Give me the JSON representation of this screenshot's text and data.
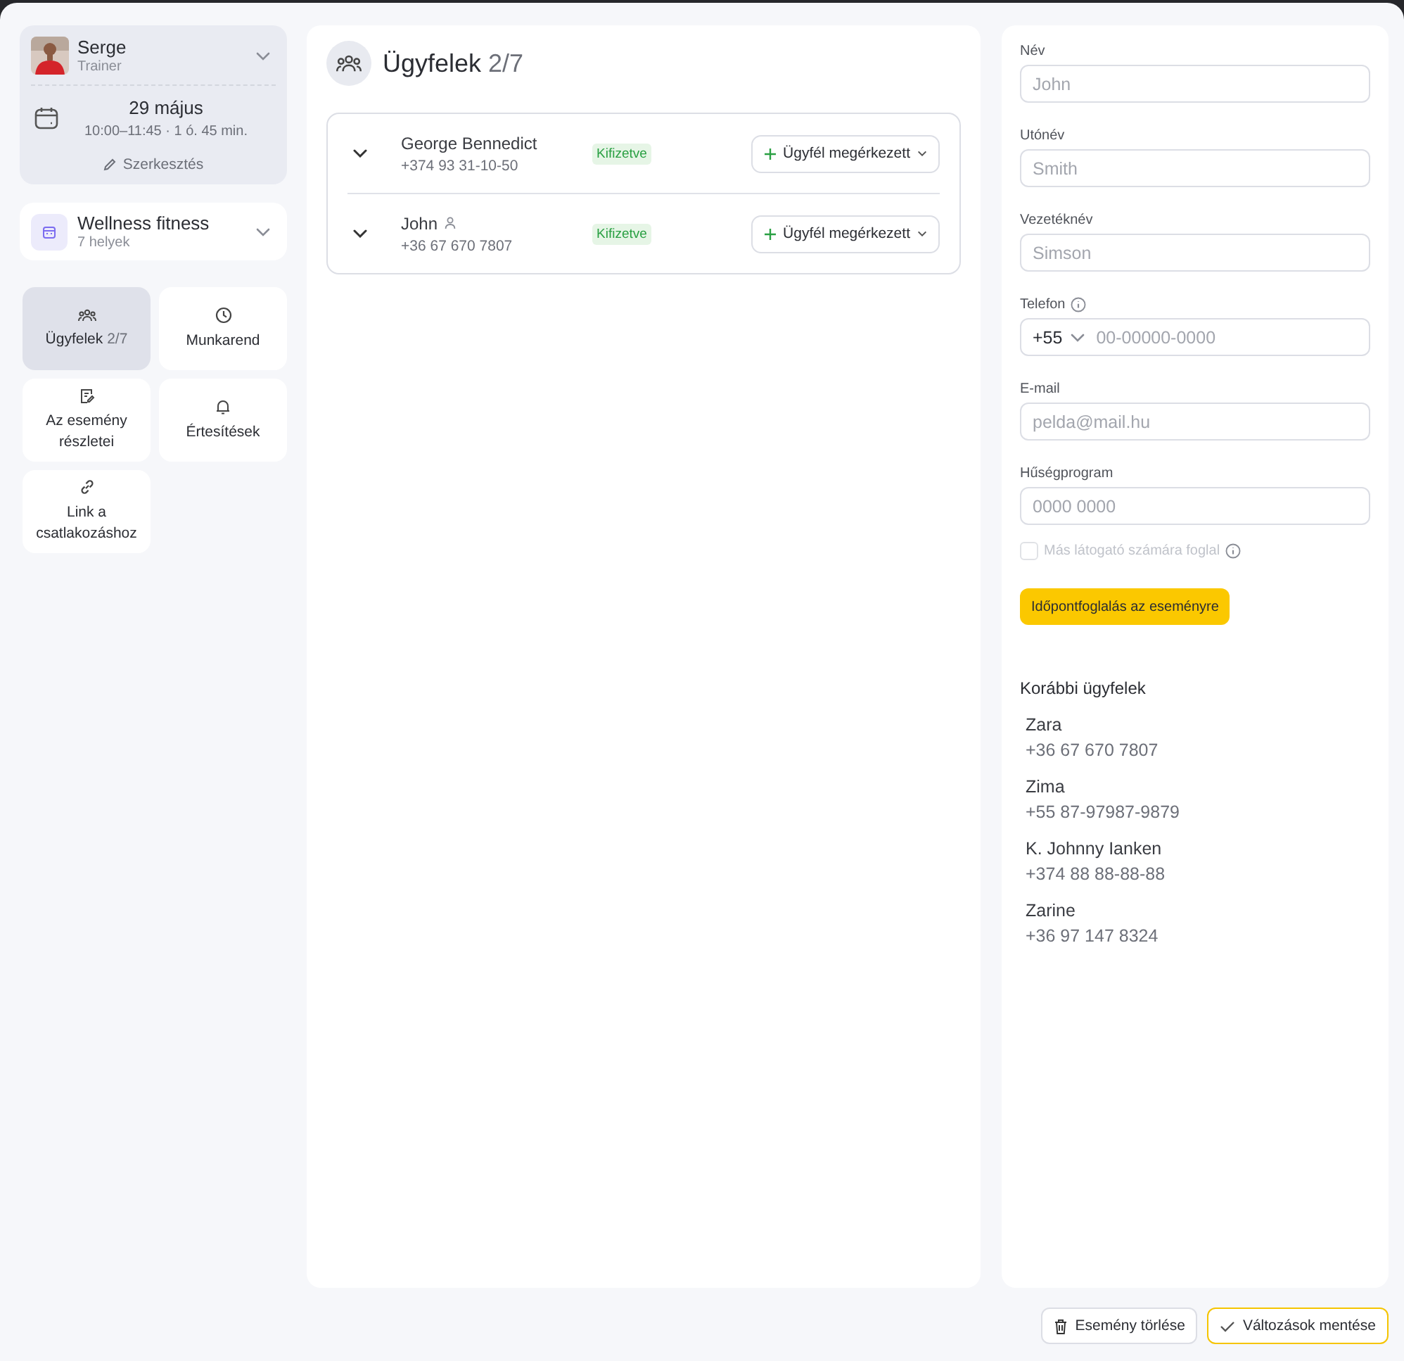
{
  "trainer": {
    "name": "Serge",
    "role": "Trainer",
    "expanded": false
  },
  "event": {
    "date": "29 május",
    "time": "10:00–11:45 · 1 ó. 45 min.",
    "edit": "Szerkesztés"
  },
  "location": {
    "name": "Wellness fitness",
    "places": "7 helyek",
    "expanded": false
  },
  "nav": [
    {
      "label": "Ügyfelek",
      "count": "2/7",
      "selected": true
    },
    {
      "label": "Munkarend",
      "selected": false
    },
    {
      "label": "Az esemény részletei",
      "selected": false
    },
    {
      "label": "Értesítések",
      "selected": false
    },
    {
      "label": "Link a csatlakozáshoz",
      "selected": false
    }
  ],
  "clients": {
    "title": "Ügyfelek",
    "count": "2/7",
    "rows": [
      {
        "name": "George Bennedict",
        "phone": "+374 93 31-10-50",
        "has_account": false,
        "status": "Kifizetve",
        "action": "Ügyfél megérkezett",
        "expanded": false
      },
      {
        "name": "John",
        "phone": "+36 67 670 7807",
        "has_account": true,
        "status": "Kifizetve",
        "action": "Ügyfél megérkezett",
        "expanded": false
      }
    ]
  },
  "form": {
    "fields": [
      {
        "kind": "text",
        "label": "Név",
        "placeholder": "John",
        "info": false
      },
      {
        "kind": "text",
        "label": "Utónév",
        "placeholder": "Smith",
        "info": false
      },
      {
        "kind": "text",
        "label": "Vezetéknév",
        "placeholder": "Simson",
        "info": false
      },
      {
        "kind": "phone",
        "label": "Telefon",
        "prefix": "+55",
        "placeholder": "00-00000-0000",
        "info": true
      },
      {
        "kind": "text",
        "label": "E-mail",
        "placeholder": "pelda@mail.hu",
        "info": false
      },
      {
        "kind": "text",
        "label": "Hűségprogram",
        "placeholder": "0000 0000",
        "info": false
      }
    ],
    "other_visitor": {
      "label": "Más látogató számára foglal",
      "checked": false,
      "disabled": true
    },
    "book_button": "Időpontfoglalás az eseményre"
  },
  "previous_clients": {
    "title": "Korábbi ügyfelek",
    "items": [
      {
        "name": "Zara",
        "phone": "+36 67 670 7807"
      },
      {
        "name": "Zima",
        "phone": "+55 87-97987-9879"
      },
      {
        "name": "K. Johnny Ianken",
        "phone": "+374 88 88-88-88"
      },
      {
        "name": "Zarine",
        "phone": "+36 97 147 8324"
      }
    ]
  },
  "footer": {
    "delete": "Esemény törlése",
    "save": "Változások mentése"
  }
}
